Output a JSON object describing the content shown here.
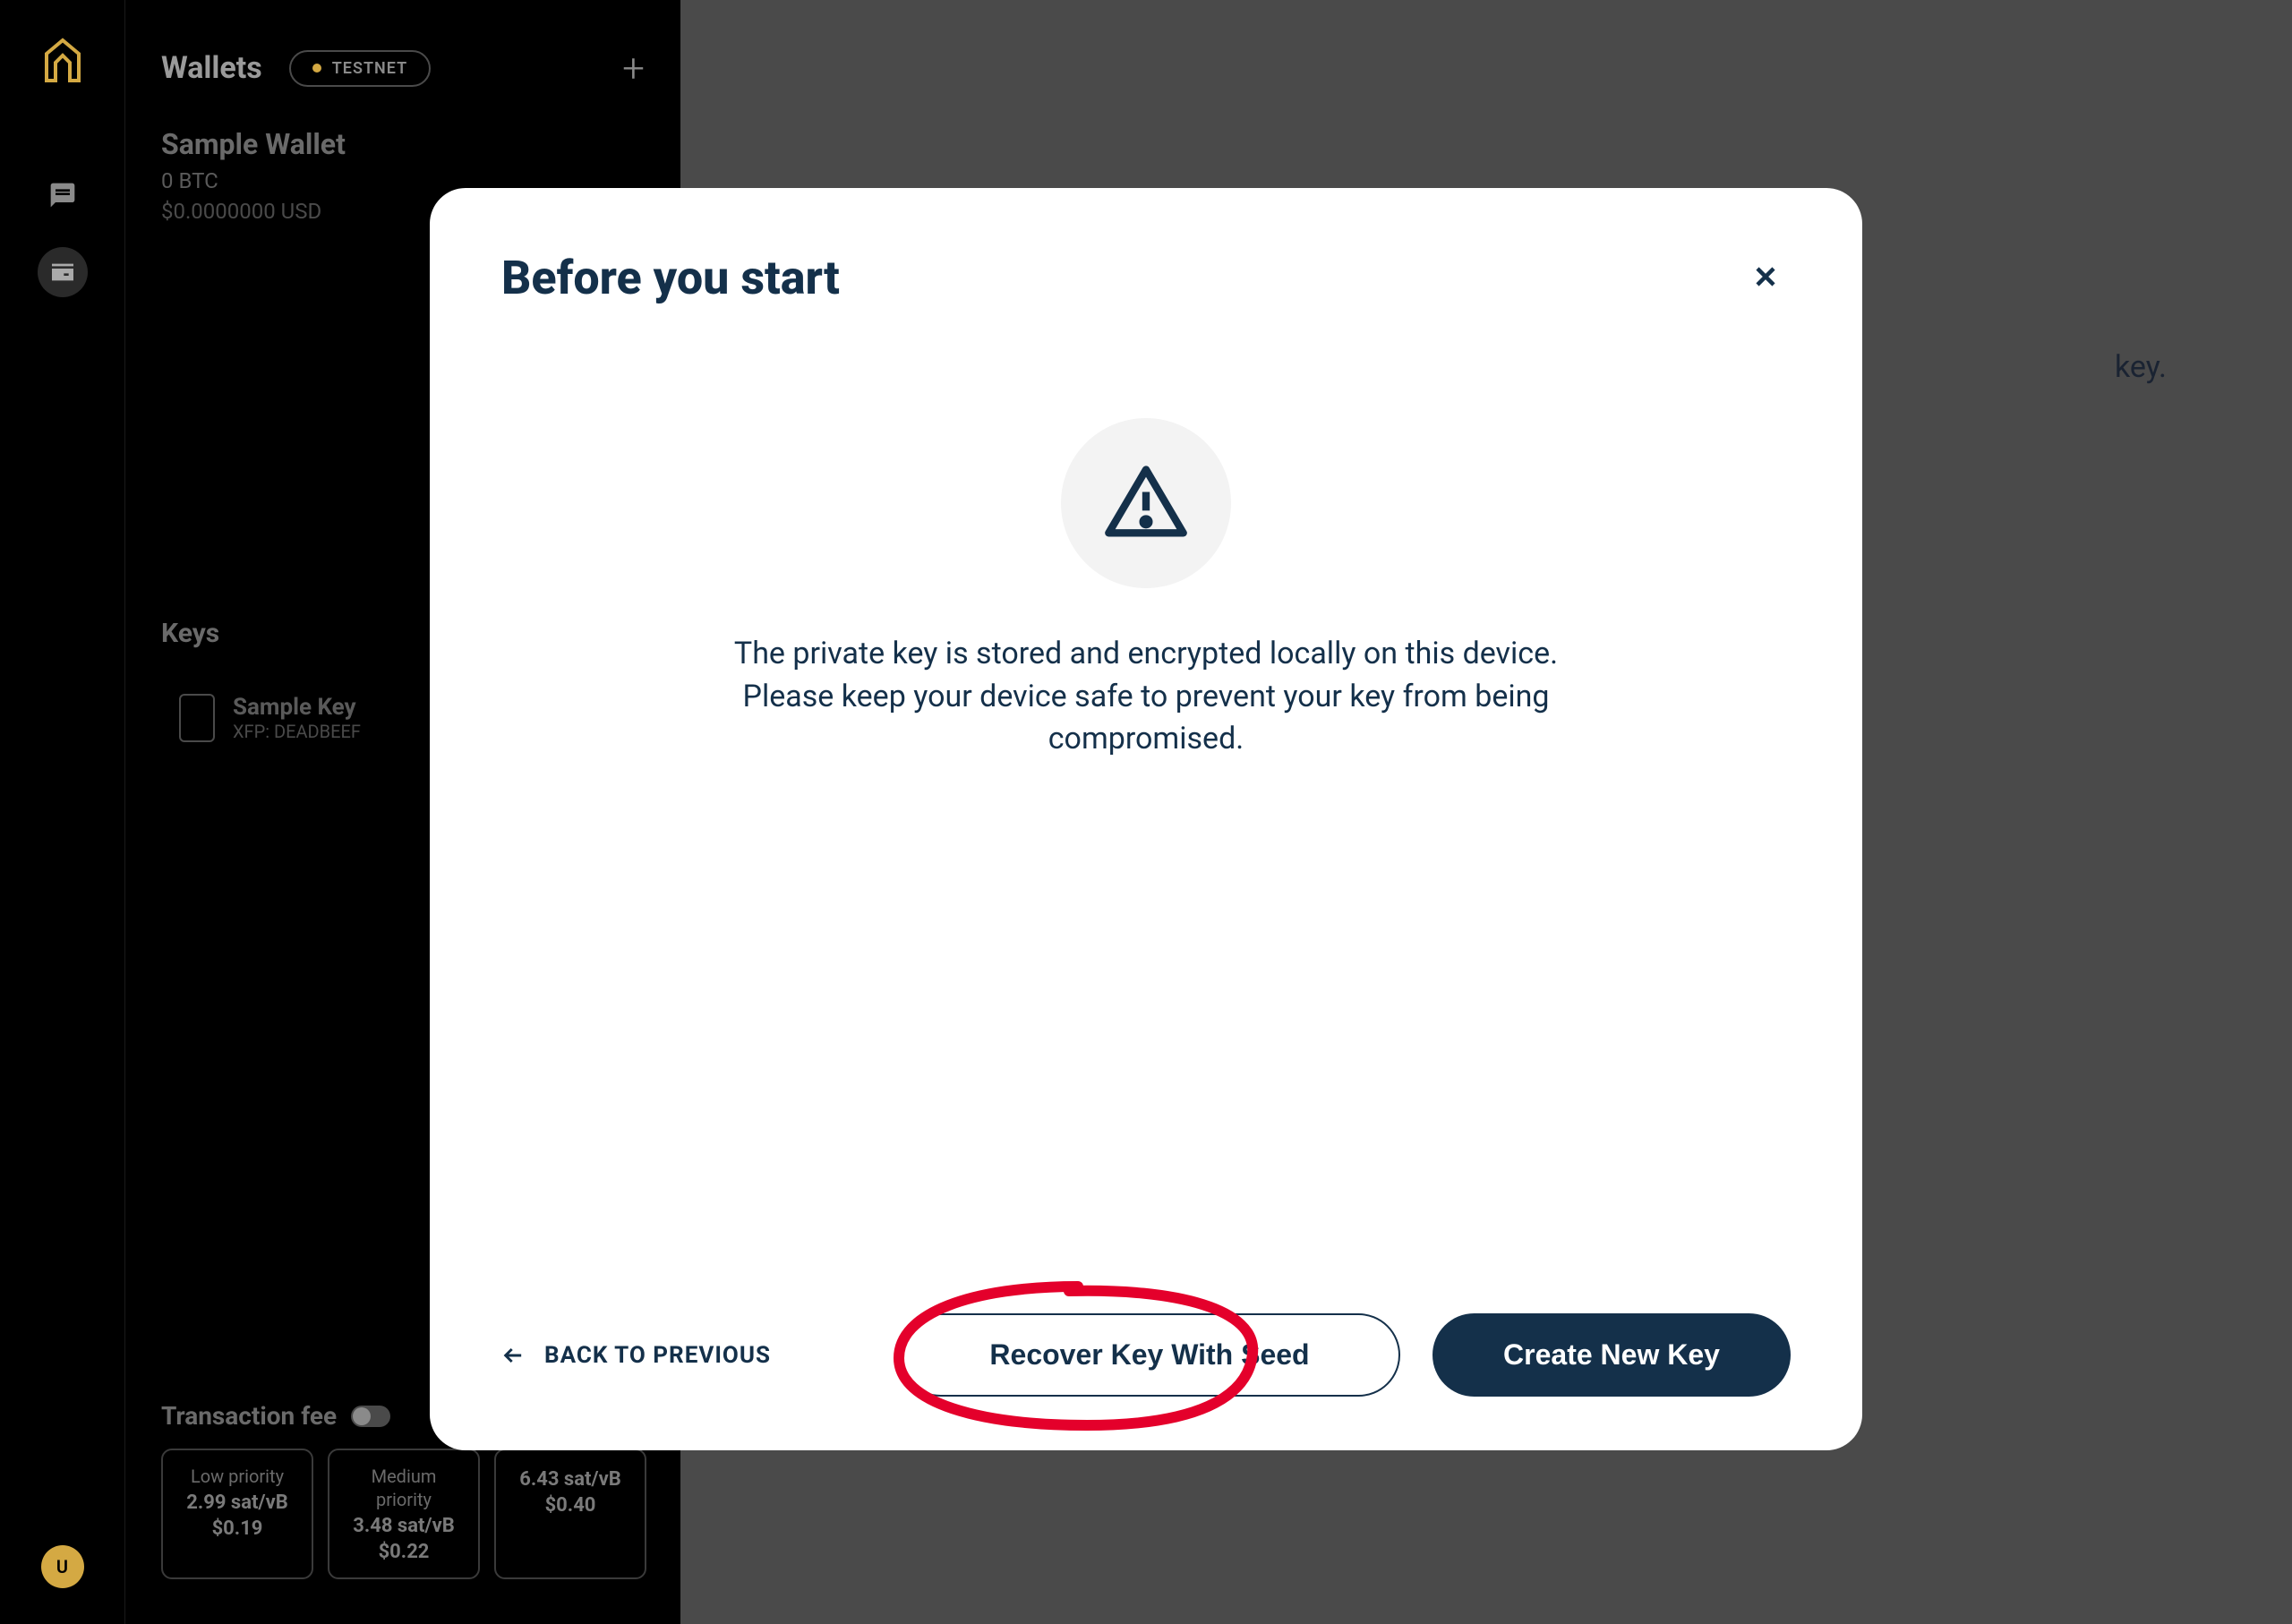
{
  "sidebar": {
    "title": "Wallets",
    "testnet": "TESTNET",
    "wallet": {
      "name": "Sample Wallet",
      "balance": "0 BTC",
      "usd": "$0.0000000 USD"
    },
    "keys_title": "Keys",
    "key": {
      "name": "Sample Key",
      "xfp": "XFP: DEADBEEF"
    },
    "fee": {
      "title": "Transaction fee",
      "options": [
        {
          "priority": "Low priority",
          "rate": "2.99 sat/vB",
          "cost": "$0.19"
        },
        {
          "priority": "Medium priority",
          "rate": "3.48 sat/vB",
          "cost": "$0.22"
        },
        {
          "priority": "",
          "rate": "6.43 sat/vB",
          "cost": "$0.40"
        }
      ]
    }
  },
  "user_initial": "U",
  "bg_hint": "key.",
  "modal": {
    "title": "Before you start",
    "body": "The private key is stored and encrypted locally on this device. Please keep your device safe to prevent your key from being compromised.",
    "back": "BACK TO PREVIOUS",
    "recover": "Recover Key With Seed",
    "create": "Create New Key"
  }
}
